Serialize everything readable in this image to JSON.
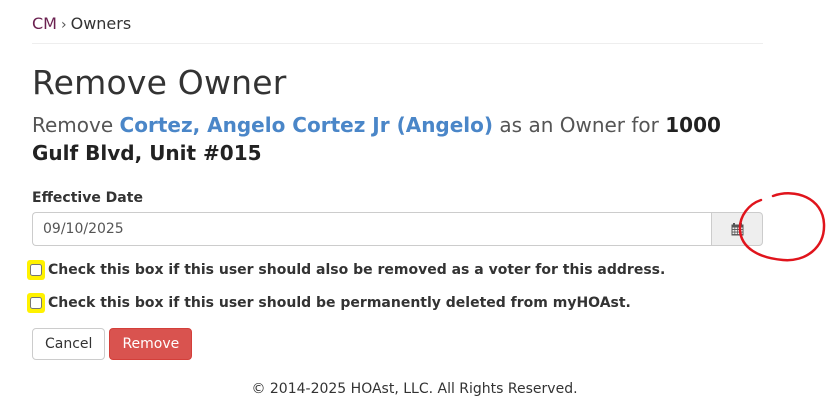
{
  "breadcrumb": {
    "root": "CM",
    "separator": "›",
    "current": "Owners"
  },
  "page": {
    "title": "Remove Owner",
    "subtitle_prefix": "Remove ",
    "owner_name": "Cortez, Angelo Cortez Jr (Angelo)",
    "subtitle_middle": " as an Owner for ",
    "property": "1000 Gulf Blvd, Unit #015"
  },
  "form": {
    "effective_date_label": "Effective Date",
    "effective_date_value": "09/10/2025",
    "checkbox_voter_label": "Check this box if this user should also be removed as a voter for this address.",
    "checkbox_delete_label": "Check this box if this user should be permanently deleted from myHOAst.",
    "cancel_label": "Cancel",
    "remove_label": "Remove"
  },
  "icons": {
    "calendar": "calendar-icon"
  },
  "colors": {
    "link": "#4a86c8",
    "breadcrumb_link": "#6b2150",
    "danger": "#d9534f",
    "highlight": "#fff200",
    "annotation_circle": "#e0141c"
  },
  "footer": {
    "copyright": "© 2014-2025 HOAst, LLC. All Rights Reserved."
  }
}
